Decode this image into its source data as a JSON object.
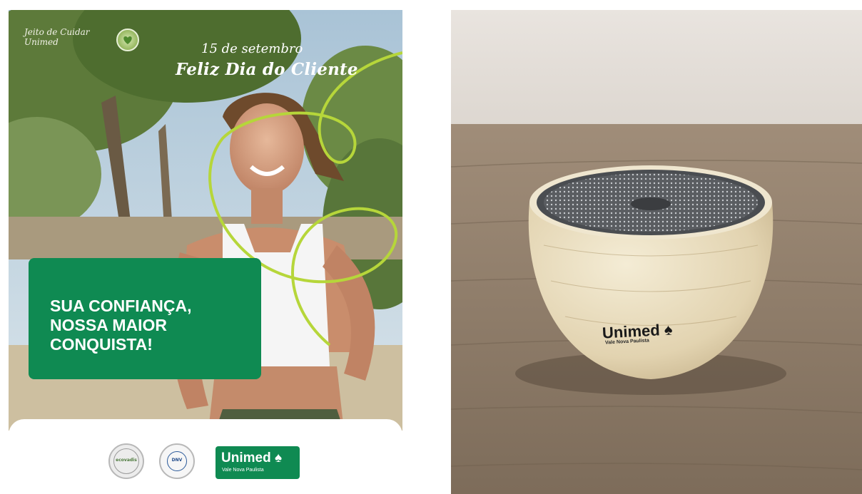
{
  "poster": {
    "brand_script": "Jeito de Cuidar Unimed",
    "date_line": "15 de setembro",
    "headline_start": "Feliz ",
    "headline_accent": "Dia do Cliente",
    "card_text": "SUA CONFIANÇA,\nNOSSA MAIOR\nCONQUISTA!",
    "logo_name": "Unimed",
    "logo_sub": "Vale Nova Paulista",
    "badge_eco_label": "ecovadis",
    "badge_dnv_label": "DNV"
  },
  "speaker": {
    "brand": "Unimed",
    "sub": "Vale Nova Paulista"
  },
  "colors": {
    "brand_green": "#0f8a52",
    "lime_line": "#b6d63a",
    "wood": "#e8dcc0",
    "table": "#8e7b68"
  }
}
